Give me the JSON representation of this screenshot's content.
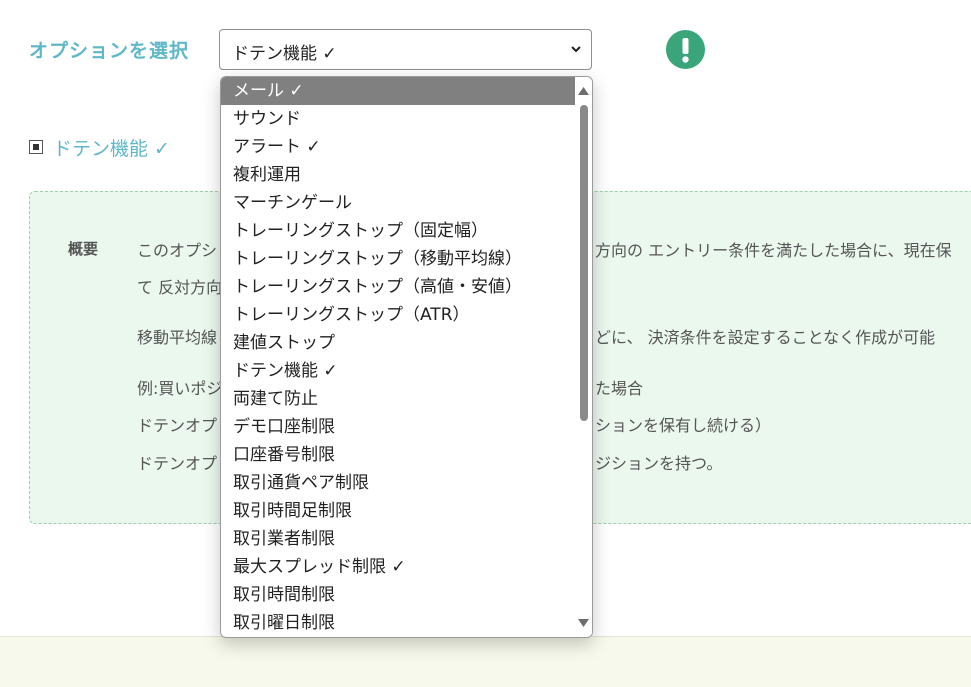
{
  "option_select": {
    "label": "オプションを選択",
    "value": "ドテン機能 ✓"
  },
  "checkbox": {
    "label": "ドテン機能 ✓"
  },
  "summary": {
    "heading": "概要",
    "lines": [
      "このオプシ",
      "方向の エントリー条件を満たした場合に、現在保",
      "て 反対方向",
      "移動平均線",
      "どに、 決済条件を設定することなく作成が可能",
      "例:買いポジ",
      "た場合",
      "ドテンオプ",
      "ションを保有し続ける）",
      "ドテンオプ",
      "ジションを持つ。"
    ]
  },
  "dropdown": {
    "items": [
      "メール ✓",
      "サウンド",
      "アラート ✓",
      "複利運用",
      "マーチンゲール",
      "トレーリングストップ（固定幅）",
      "トレーリングストップ（移動平均線）",
      "トレーリングストップ（高値・安値）",
      "トレーリングストップ（ATR）",
      "建値ストップ",
      "ドテン機能 ✓",
      "両建て防止",
      "デモ口座制限",
      "口座番号制限",
      "取引通貨ペア制限",
      "取引時間足制限",
      "取引業者制限",
      "最大スプレッド制限 ✓",
      "取引時間制限",
      "取引曜日制限"
    ],
    "highlighted_index": 0
  },
  "colors": {
    "accent": "#5fb7c8",
    "alert": "#3aa57a",
    "summary_bg": "#ebf8ee",
    "highlight": "#808080"
  },
  "icons": {
    "alert": "exclamation-circle-icon",
    "select": "chevron-down-icon",
    "scroll_up": "triangle-up-icon",
    "scroll_down": "triangle-down-icon"
  }
}
